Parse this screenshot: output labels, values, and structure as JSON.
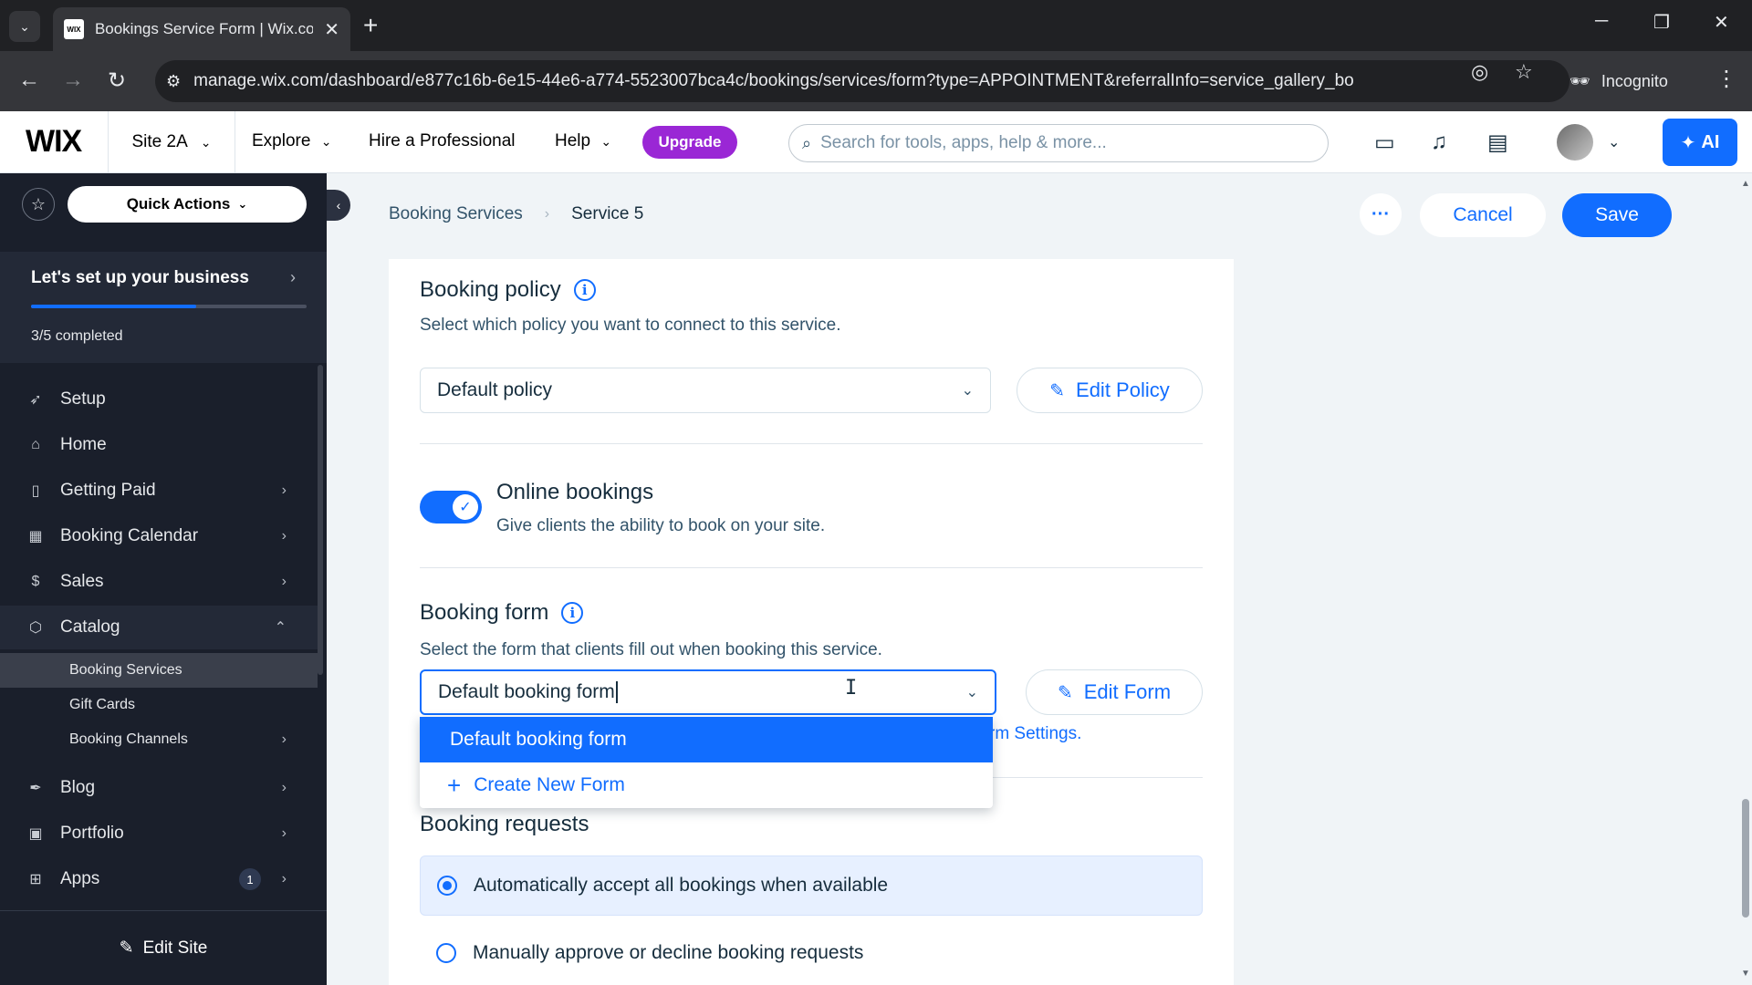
{
  "browser": {
    "tab_title": "Bookings Service Form | Wix.com",
    "favicon_text": "WIX",
    "url": "manage.wix.com/dashboard/e877c16b-6e15-44e6-a774-5523007bca4c/bookings/services/form?type=APPOINTMENT&referralInfo=service_gallery_bo",
    "incognito_label": "Incognito"
  },
  "topbar": {
    "logo": "WIX",
    "site_name": "Site 2A",
    "nav": [
      "Explore",
      "Hire a Professional",
      "Help"
    ],
    "upgrade_label": "Upgrade",
    "search_placeholder": "Search for tools, apps, help & more...",
    "ai_label": "AI"
  },
  "sidebar": {
    "quick_actions": "Quick Actions",
    "setup": {
      "title": "Let's set up your business",
      "count": "3/5 completed",
      "progress": 0.6
    },
    "items": [
      {
        "label": "Setup",
        "icon": "rocket-icon"
      },
      {
        "label": "Home",
        "icon": "home-icon"
      },
      {
        "label": "Getting Paid",
        "icon": "invoice-icon"
      },
      {
        "label": "Booking Calendar",
        "icon": "calendar-icon"
      },
      {
        "label": "Sales",
        "icon": "dollar-icon"
      },
      {
        "label": "Catalog",
        "icon": "catalog-icon"
      }
    ],
    "catalog_sub": [
      "Booking Services",
      "Gift Cards",
      "Booking Channels"
    ],
    "items_after": [
      {
        "label": "Blog",
        "icon": "pen-nib-icon"
      },
      {
        "label": "Portfolio",
        "icon": "portfolio-icon"
      },
      {
        "label": "Apps",
        "icon": "apps-icon",
        "badge": "1"
      }
    ],
    "edit_site": "Edit Site"
  },
  "header": {
    "breadcrumb_root": "Booking Services",
    "breadcrumb_current": "Service 5",
    "more_label": "···",
    "cancel_label": "Cancel",
    "save_label": "Save"
  },
  "policy": {
    "title": "Booking policy",
    "desc": "Select which policy you want to connect to this service.",
    "selected": "Default policy",
    "edit_label": "Edit Policy"
  },
  "online": {
    "title": "Online bookings",
    "desc": "Give clients the ability to book on your site.",
    "enabled": true
  },
  "form": {
    "title": "Booking form",
    "desc": "Select the form that clients fill out when booking this service.",
    "value": "Default booking form",
    "edit_label": "Edit Form",
    "partial_link": "rm Settings.",
    "options": [
      "Default booking form"
    ],
    "create_label": "Create New Form"
  },
  "requests": {
    "title": "Booking requests",
    "options": [
      {
        "label": "Automatically accept all bookings when available",
        "selected": true
      },
      {
        "label": "Manually approve or decline booking requests",
        "selected": false
      }
    ]
  }
}
